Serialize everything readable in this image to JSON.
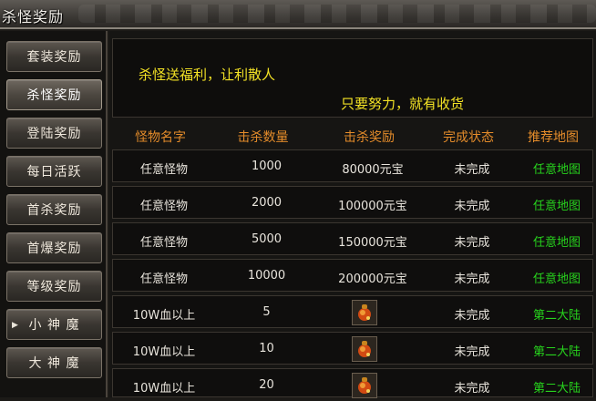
{
  "window": {
    "title": "杀怪奖励"
  },
  "sidebar": {
    "tabs": [
      {
        "label": "套装奖励"
      },
      {
        "label": "杀怪奖励"
      },
      {
        "label": "登陆奖励"
      },
      {
        "label": "每日活跃"
      },
      {
        "label": "首杀奖励"
      },
      {
        "label": "首爆奖励"
      },
      {
        "label": "等级奖励"
      },
      {
        "label": "小 神 魔"
      },
      {
        "label": "大 神 魔"
      }
    ],
    "active_index": 1
  },
  "panel": {
    "message_line1": "杀怪送福利，让利散人",
    "message_line2": "只要努力，就有收货"
  },
  "table": {
    "headers": [
      "怪物名字",
      "击杀数量",
      "击杀奖励",
      "完成状态",
      "推荐地图"
    ],
    "rows": [
      {
        "monster": "任意怪物",
        "count": "1000",
        "reward": "80000元宝",
        "status": "未完成",
        "map": "任意地图"
      },
      {
        "monster": "任意怪物",
        "count": "2000",
        "reward": "100000元宝",
        "status": "未完成",
        "map": "任意地图"
      },
      {
        "monster": "任意怪物",
        "count": "5000",
        "reward": "150000元宝",
        "status": "未完成",
        "map": "任意地图"
      },
      {
        "monster": "任意怪物",
        "count": "10000",
        "reward": "200000元宝",
        "status": "未完成",
        "map": "任意地图"
      },
      {
        "monster": "10W血以上",
        "count": "5",
        "reward": "",
        "reward_icon": "gourd-pouch-icon",
        "status": "未完成",
        "map": "第二大陆"
      },
      {
        "monster": "10W血以上",
        "count": "10",
        "reward": "",
        "reward_icon": "gourd-pouch-icon",
        "status": "未完成",
        "map": "第二大陆"
      },
      {
        "monster": "10W血以上",
        "count": "20",
        "reward": "",
        "reward_icon": "gourd-pouch-icon",
        "status": "未完成",
        "map": "第二大陆"
      }
    ]
  },
  "colors": {
    "header_text": "#e38b2a",
    "message_text": "#f3e225",
    "map_text": "#27d41d"
  }
}
